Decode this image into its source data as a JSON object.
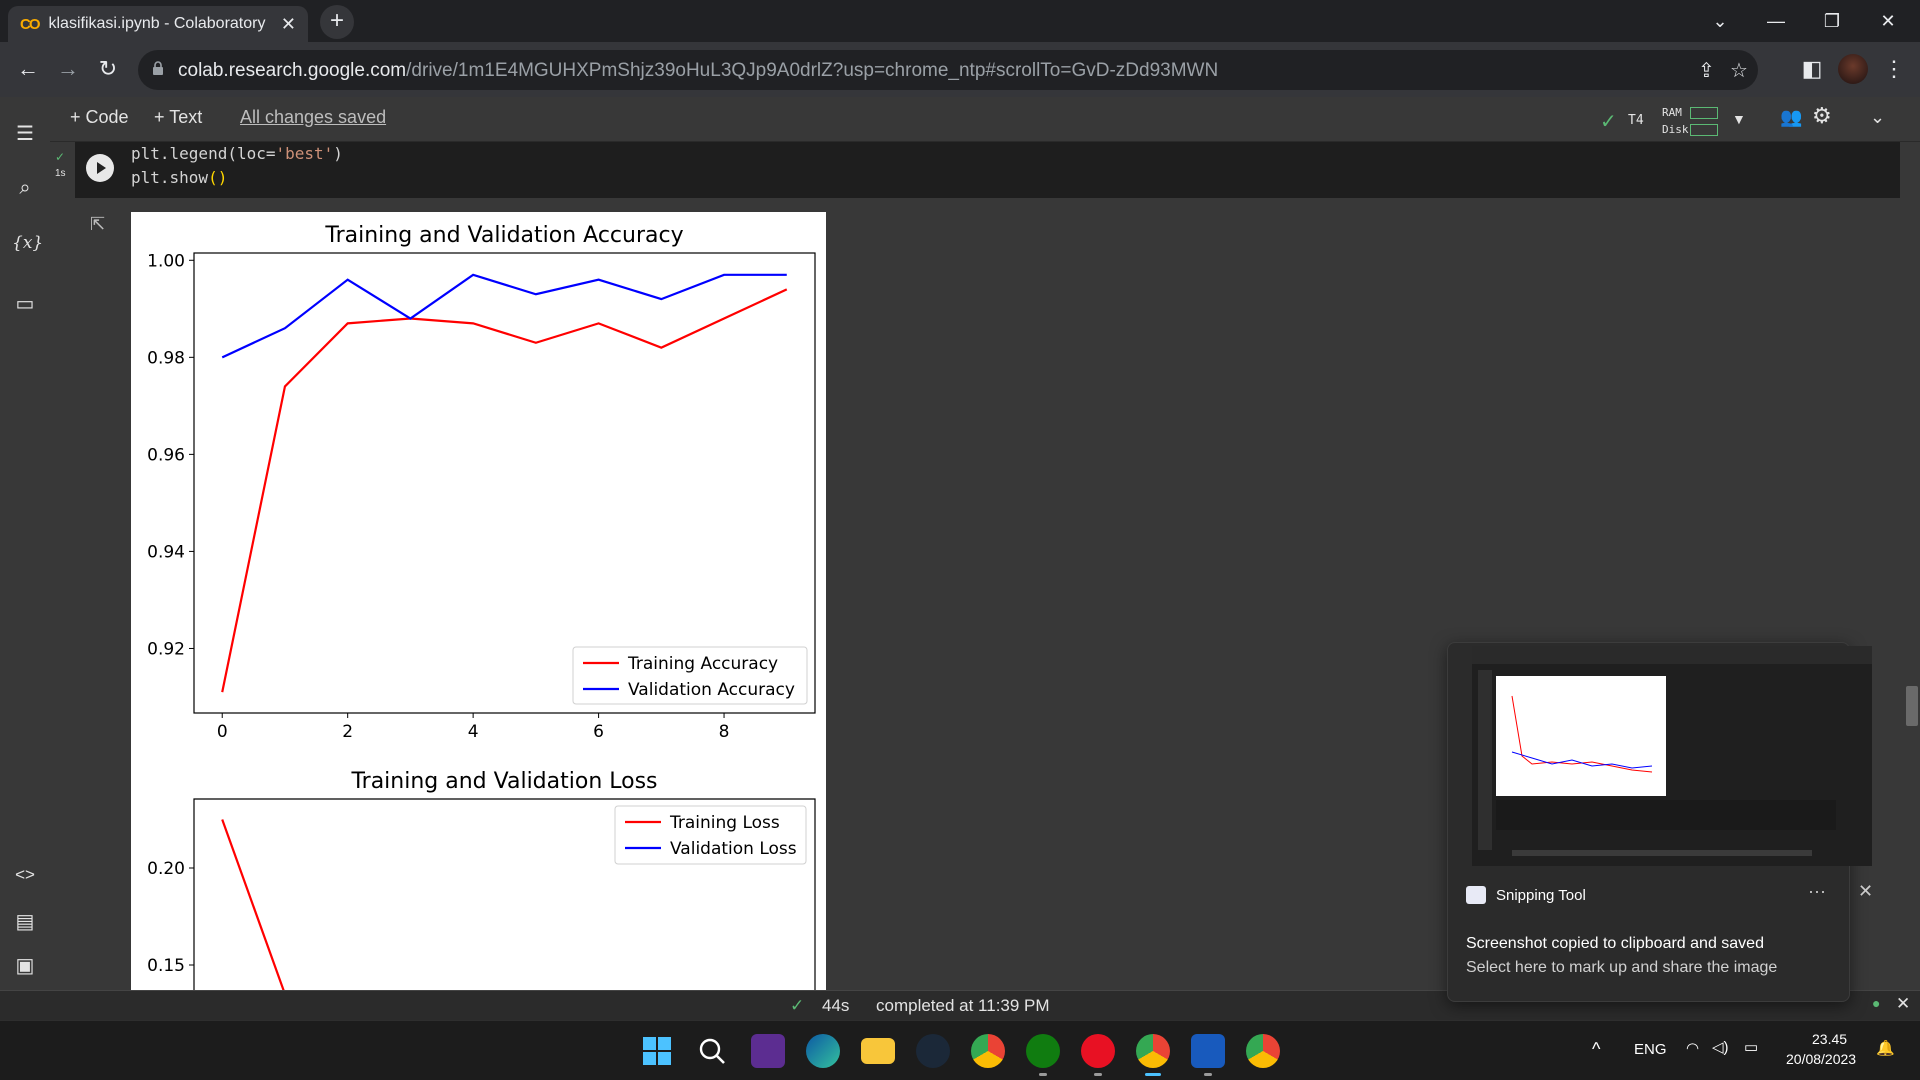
{
  "browser": {
    "tab_title": "klasifikasi.ipynb - Colaboratory",
    "tab_close": "✕",
    "new_tab": "+",
    "url_host": "colab.research.google.com",
    "url_path": "/drive/1m1E4MGUHXPmShjz39oHuL3QJp9A0drlZ?usp=chrome_ntp#scrollTo=GvD-zDd93MWN",
    "window_controls": {
      "tabs_menu": "⌄",
      "minimize": "—",
      "restore": "❐",
      "close": "✕"
    }
  },
  "colab": {
    "add_code": "+ Code",
    "add_text": "+ Text",
    "save_status": "All changes saved",
    "runtime": {
      "gpu": "T4",
      "ram_label": "RAM",
      "disk_label": "Disk"
    },
    "cell": {
      "exec_time": "1s",
      "code_line1_a": "plt.legend(loc=",
      "code_line1_str": "'best'",
      "code_line1_b": ")",
      "code_line2_a": "plt.show",
      "code_line2_par": "()"
    },
    "status": {
      "duration": "44s",
      "completed": "completed at 11:39 PM"
    }
  },
  "chart_data": [
    {
      "type": "line",
      "title": "Training and Validation Accuracy",
      "x": [
        0,
        1,
        2,
        3,
        4,
        5,
        6,
        7,
        8,
        9
      ],
      "series": [
        {
          "name": "Training Accuracy",
          "color": "#ff0000",
          "values": [
            0.911,
            0.974,
            0.987,
            0.988,
            0.987,
            0.983,
            0.987,
            0.982,
            0.988,
            0.994
          ]
        },
        {
          "name": "Validation Accuracy",
          "color": "#0000ff",
          "values": [
            0.98,
            0.986,
            0.996,
            0.988,
            0.997,
            0.993,
            0.996,
            0.992,
            0.997,
            0.997
          ]
        }
      ],
      "xticks": [
        "0",
        "2",
        "4",
        "6",
        "8"
      ],
      "yticks": [
        "0.92",
        "0.94",
        "0.96",
        "0.98",
        "1.00"
      ],
      "xlim": [
        -0.45,
        9.45
      ],
      "ylim": [
        0.9067,
        1.0015
      ],
      "legend": "lower-right"
    },
    {
      "type": "line",
      "title": "Training and Validation Loss",
      "x": [
        0,
        1
      ],
      "series": [
        {
          "name": "Training Loss",
          "color": "#ff0000",
          "values": [
            0.225,
            0.135
          ]
        },
        {
          "name": "Validation Loss",
          "color": "#0000ff",
          "values": []
        }
      ],
      "yticks": [
        "0.15",
        "0.20"
      ],
      "legend": "upper-right"
    }
  ],
  "toast": {
    "app_name": "Snipping Tool",
    "more": "···",
    "close": "✕",
    "message": "Screenshot copied to clipboard and saved",
    "sub": "Select here to mark up and share the image"
  },
  "taskbar": {
    "language": "ENG",
    "time": "23.45",
    "date": "20/08/2023"
  }
}
